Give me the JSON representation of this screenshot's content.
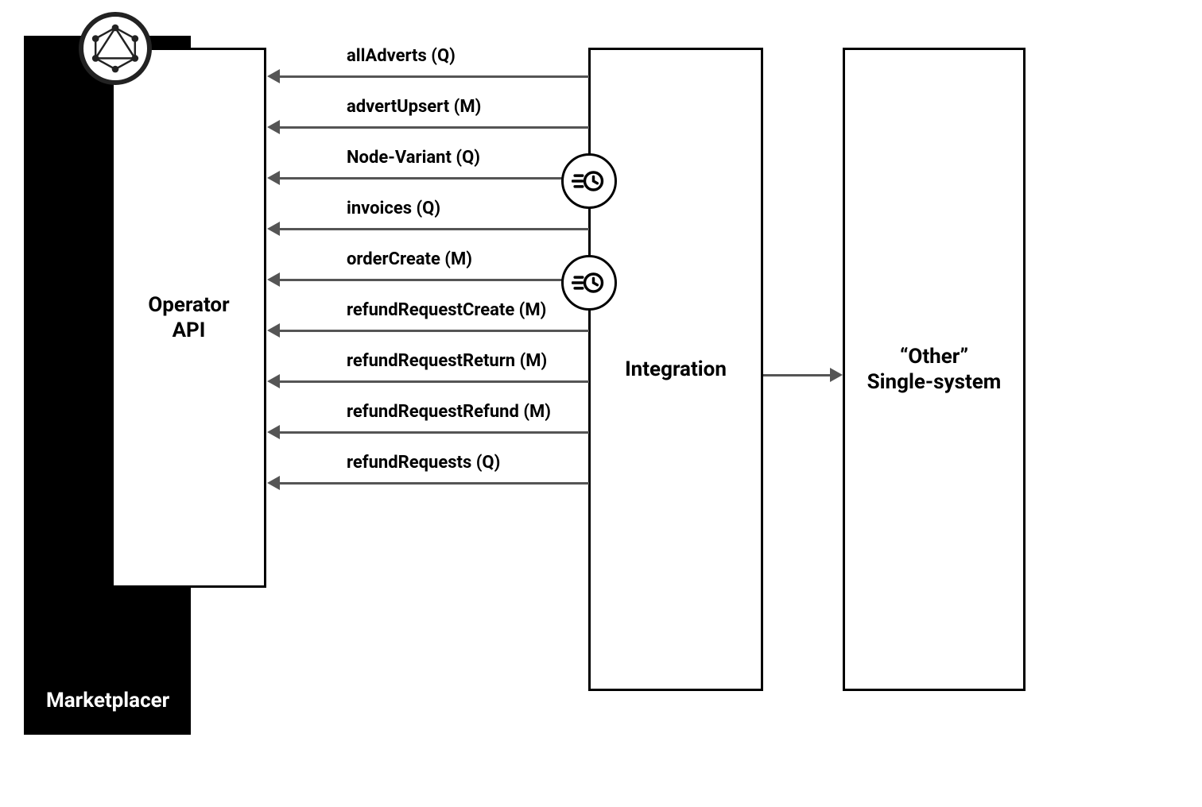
{
  "boxes": {
    "marketplacer": {
      "label": "Marketplacer"
    },
    "operator": {
      "label": "Operator API",
      "line1": "Operator",
      "line2": "API"
    },
    "integration": {
      "label": "Integration"
    },
    "other": {
      "label": "\"Other\" Single-system",
      "line1": "“Other”",
      "line2": "Single-system"
    }
  },
  "arrows": [
    {
      "label": "allAdverts (Q)"
    },
    {
      "label": "advertUpsert (M)"
    },
    {
      "label": "Node-Variant (Q)"
    },
    {
      "label": "invoices (Q)"
    },
    {
      "label": "orderCreate (M)"
    },
    {
      "label": "refundRequestCreate (M)"
    },
    {
      "label": "refundRequestReturn (M)"
    },
    {
      "label": "refundRequestRefund (M)"
    },
    {
      "label": "refundRequests (Q)"
    }
  ],
  "icons": {
    "graphql": "graphql-icon",
    "clock": "speed-clock-icon"
  }
}
